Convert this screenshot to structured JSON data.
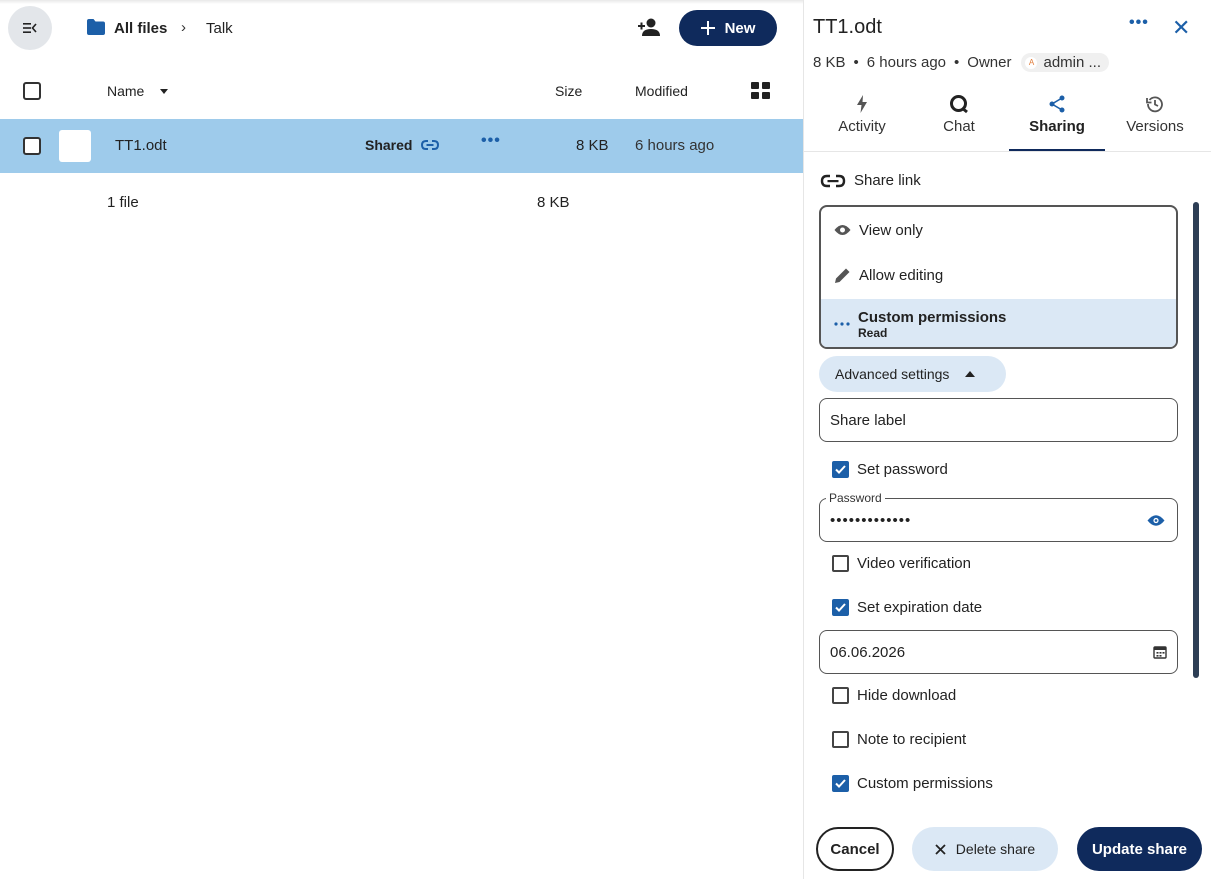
{
  "breadcrumb": {
    "root_label": "All files",
    "separator": "›",
    "current": "Talk"
  },
  "toolbar": {
    "new_label": "New",
    "new_icon": "plus-icon",
    "share_icon": "person-add-icon"
  },
  "file_list": {
    "columns": {
      "name": "Name",
      "size": "Size",
      "modified": "Modified"
    },
    "rows": [
      {
        "name": "TT1.odt",
        "shared_label": "Shared",
        "actions_label": "•••",
        "size": "8 KB",
        "modified": "6 hours ago"
      }
    ],
    "summary": {
      "count": "1 file",
      "size": "8 KB"
    }
  },
  "sidebar": {
    "title": "TT1.odt",
    "more_label": "•••",
    "close_label": "✕",
    "meta": {
      "size": "8 KB",
      "sep": "•",
      "time": "6 hours ago",
      "owner_label": "Owner",
      "owner_initial": "A",
      "owner_name": "admin ..."
    },
    "tabs": [
      {
        "label": "Activity",
        "icon": "bolt-icon"
      },
      {
        "label": "Chat",
        "icon": "chat-icon"
      },
      {
        "label": "Sharing",
        "icon": "share-icon",
        "active": true
      },
      {
        "label": "Versions",
        "icon": "history-icon"
      }
    ],
    "share_link_label": "Share link",
    "permissions": {
      "options": [
        {
          "label": "View only",
          "icon": "eye-icon"
        },
        {
          "label": "Allow editing",
          "icon": "pencil-icon"
        },
        {
          "label": "Custom permissions",
          "sub": "Read",
          "icon": "dots-icon",
          "selected": true
        }
      ]
    },
    "advanced_settings_label": "Advanced settings",
    "share_label_placeholder": "Share label",
    "set_password": {
      "label": "Set password",
      "checked": true
    },
    "password_field": {
      "legend": "Password",
      "value": "•••••••••••••"
    },
    "video_verification": {
      "label": "Video verification",
      "checked": false
    },
    "set_expiration": {
      "label": "Set expiration date",
      "checked": true
    },
    "expiration_date": "06.06.2026",
    "hide_download": {
      "label": "Hide download",
      "checked": false
    },
    "note_to_recipient": {
      "label": "Note to recipient",
      "checked": false
    },
    "custom_permissions": {
      "label": "Custom permissions",
      "checked": true
    },
    "buttons": {
      "cancel": "Cancel",
      "delete": "Delete share",
      "update": "Update share"
    }
  },
  "colors": {
    "accent": "#0f2a5c",
    "selected_row": "#9ecbeb",
    "link_blue": "#1c5fa8",
    "chip_bg": "#dbe8f5"
  }
}
